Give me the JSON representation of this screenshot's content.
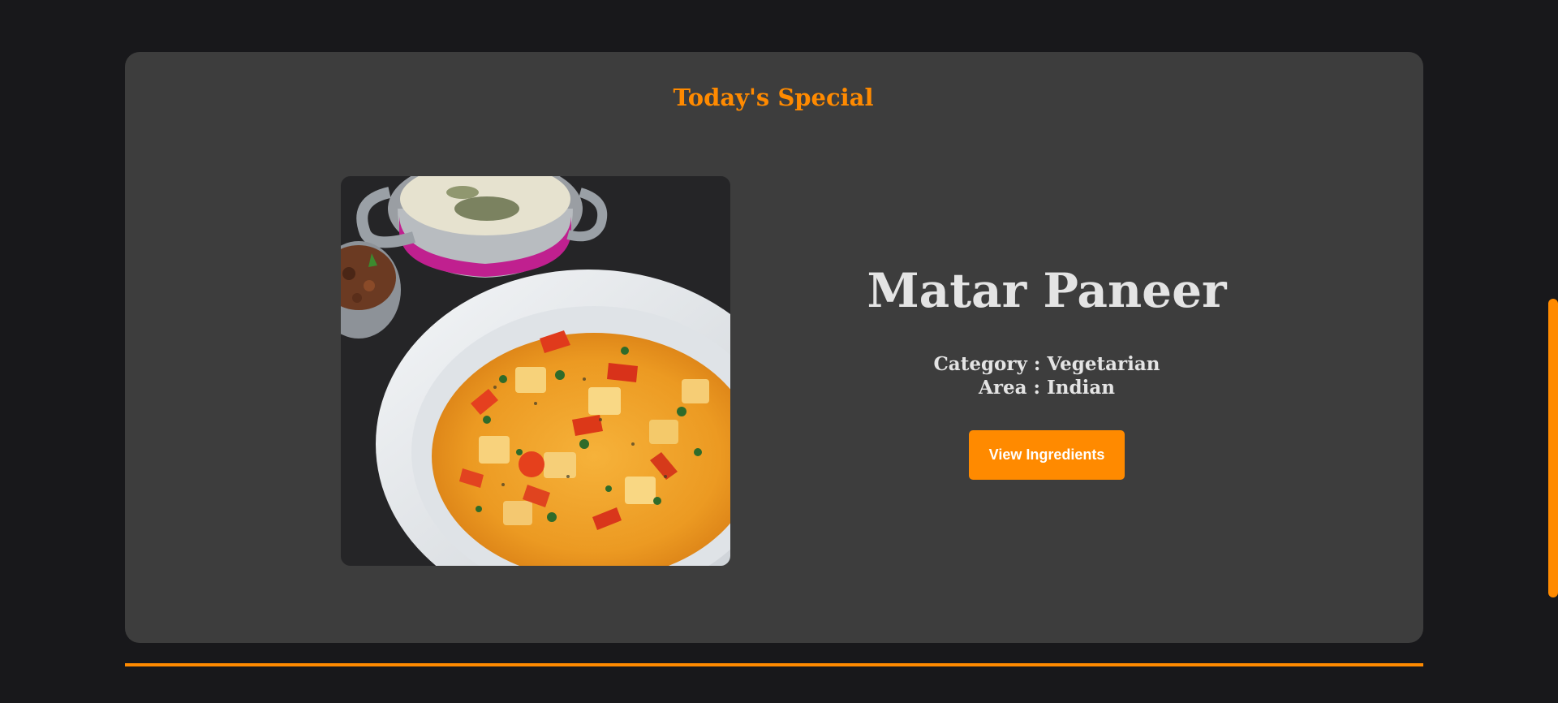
{
  "section": {
    "title": "Today's Special"
  },
  "meal": {
    "name": "Matar Paneer",
    "category_label": "Category : ",
    "category": "Vegetarian",
    "area_label": "Area : ",
    "area": "Indian",
    "image_alt": "Matar Paneer"
  },
  "actions": {
    "view_ingredients": "View Ingredients"
  },
  "colors": {
    "background": "#18181b",
    "card": "#3d3d3d",
    "accent": "#ff8a00",
    "text": "#e4e4e4"
  }
}
